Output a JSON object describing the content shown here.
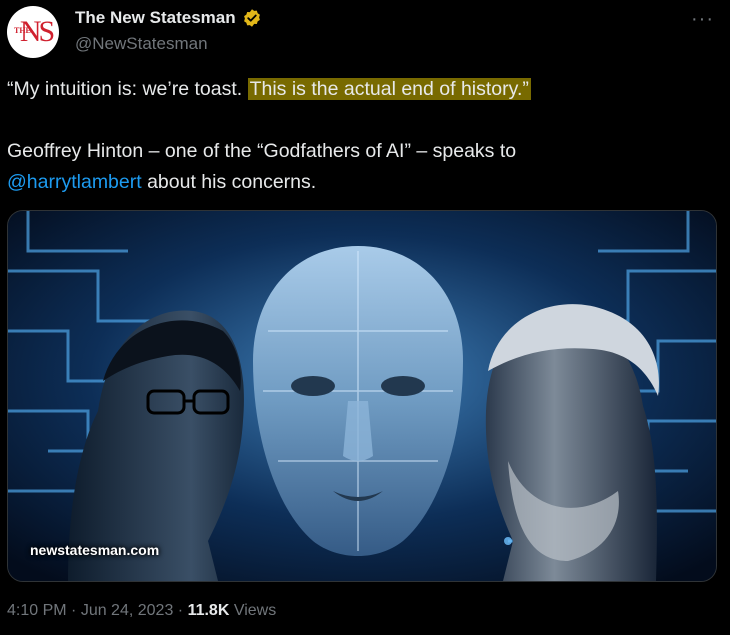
{
  "account": {
    "display_name": "The New Statesman",
    "handle": "@NewStatesman",
    "avatar_text": "NS",
    "avatar_small": "THE",
    "verified_icon": "verified-badge-icon"
  },
  "tweet": {
    "text_plain": "“My intuition is: we’re toast. ",
    "text_highlighted": "This is the actual end of history.”",
    "line2_pre": "Geoffrey Hinton – one of the “Godfathers of AI” – speaks to",
    "mention": "@harrytlambert",
    "line3_post": " about his concerns."
  },
  "media": {
    "domain": "newstatesman.com"
  },
  "meta": {
    "time": "4:10 PM",
    "sep1": " · ",
    "date": "Jun 24, 2023",
    "sep2": " · ",
    "views_count": "11.8K",
    "views_label": " Views"
  },
  "colors": {
    "highlight": "#786a00",
    "mention": "#1d9bf0",
    "badge": "#e2b719",
    "brand": "#d0202e"
  }
}
